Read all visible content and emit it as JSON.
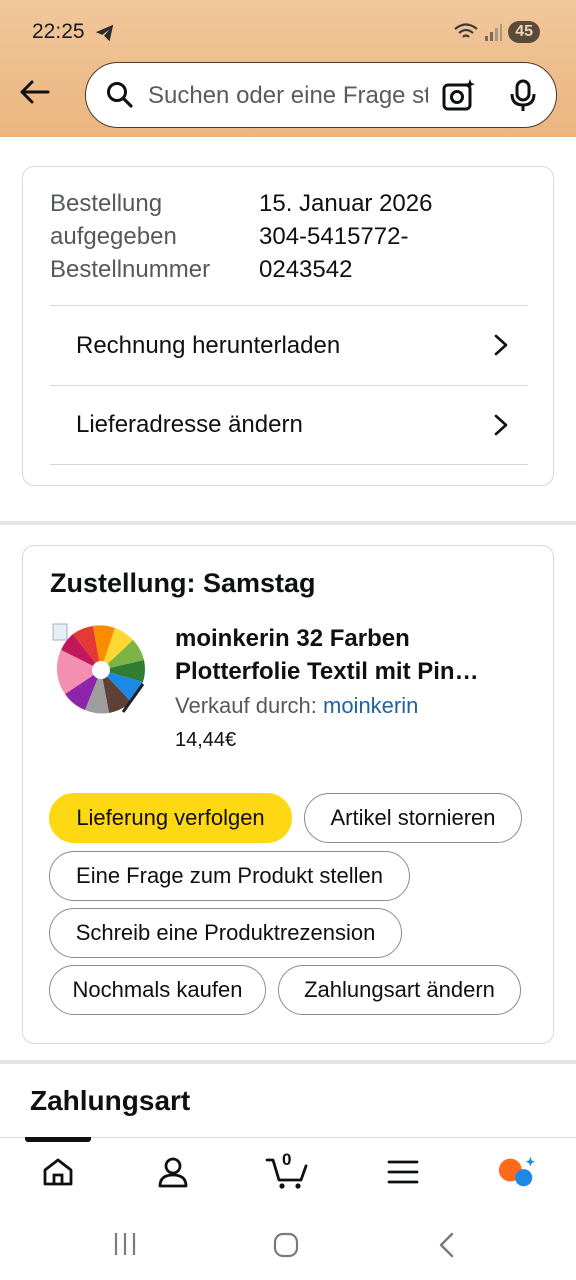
{
  "status_bar": {
    "time": "22:25",
    "battery": "45"
  },
  "search": {
    "placeholder": "Suchen oder eine Frage stellen"
  },
  "order_info": {
    "labels": [
      "Bestellung",
      "aufgegeben",
      "Bestellnummer"
    ],
    "values": [
      "15. Januar 2026",
      "304-5415772-",
      "0243542"
    ],
    "links": [
      "Rechnung herunterladen",
      "Lieferadresse ändern"
    ]
  },
  "delivery": {
    "title": "Zustellung: Samstag",
    "product_name_line1": "moinkerin 32 Farben",
    "product_name_line2": "Plotterfolie Textil mit Pin…",
    "seller_prefix": "Verkauf durch:",
    "seller": "moinkerin",
    "price": "14,44€",
    "actions": {
      "track": "Lieferung verfolgen",
      "cancel": "Artikel stornieren",
      "ask": "Eine Frage zum Produkt stellen",
      "review": "Schreib eine Produktrezension",
      "buy_again": "Nochmals kaufen",
      "change_payment": "Zahlungsart ändern"
    }
  },
  "payment": {
    "title": "Zahlungsart"
  },
  "bottom_nav": {
    "cart_count": "0"
  },
  "colors": {
    "header": "#ebb57f",
    "primary_button": "#ffd814",
    "link": "#2162a1"
  }
}
